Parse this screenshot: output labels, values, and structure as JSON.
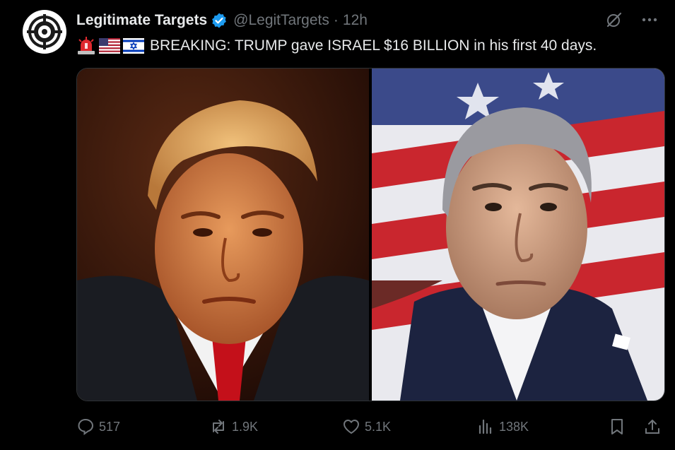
{
  "account": {
    "display_name": "Legitimate Targets",
    "handle": "@LegitTargets",
    "separator": "·",
    "time": "12h",
    "verified": true
  },
  "tweet": {
    "emojis": [
      "rotating-light",
      "us-flag",
      "israel-flag"
    ],
    "text": "BREAKING: TRUMP gave ISRAEL $16 BILLION in his first 40 days."
  },
  "media": {
    "images": [
      {
        "subject": "portrait-left"
      },
      {
        "subject": "portrait-right"
      }
    ]
  },
  "actions": {
    "replies": "517",
    "reposts": "1.9K",
    "likes": "5.1K",
    "views": "138K"
  },
  "colors": {
    "background": "#000000",
    "text_primary": "#e7e9ea",
    "text_secondary": "#71767b",
    "verified_blue": "#1d9bf0"
  },
  "icons": [
    "grok-icon",
    "more-icon",
    "reply-icon",
    "repost-icon",
    "like-icon",
    "views-icon",
    "bookmark-icon",
    "share-icon"
  ]
}
